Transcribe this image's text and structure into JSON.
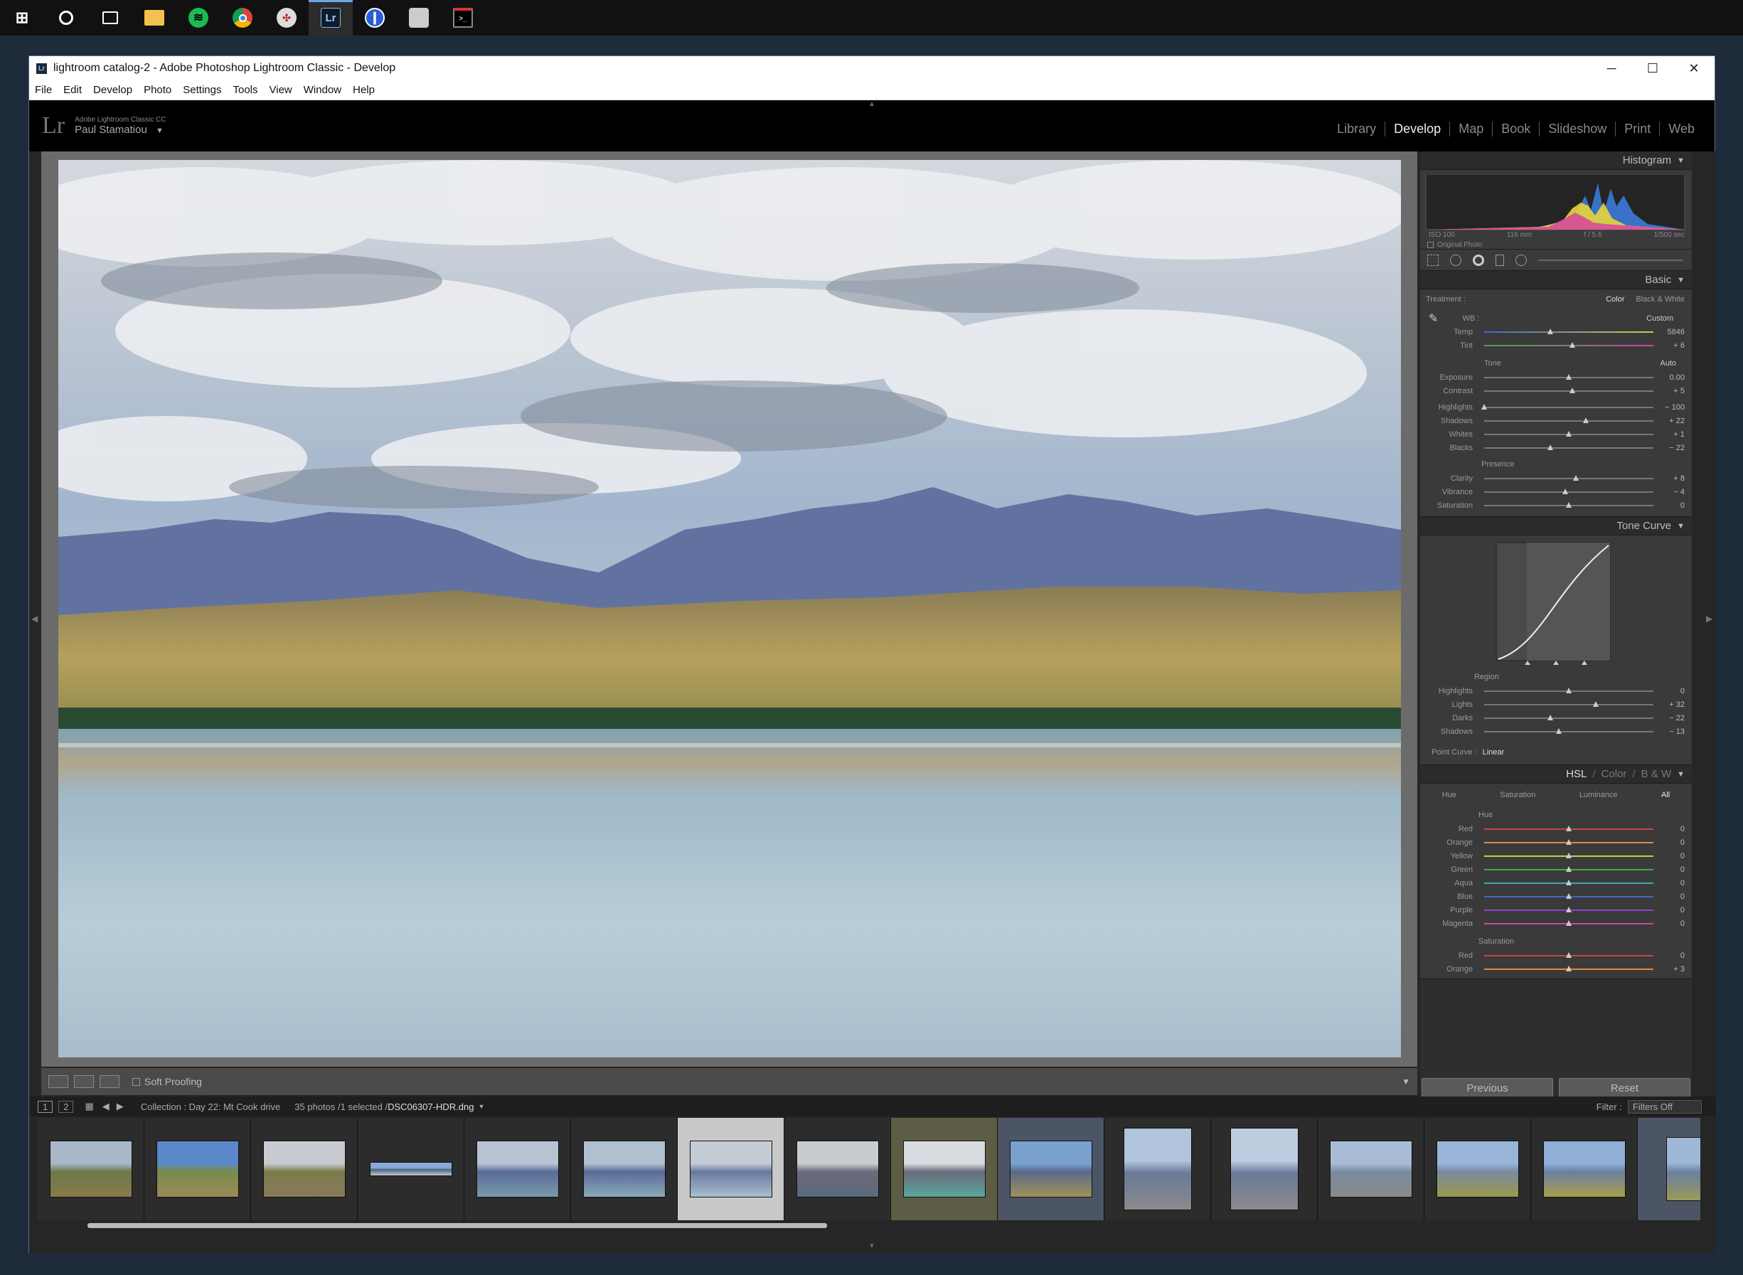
{
  "taskbar": {
    "icons": [
      "windows-start-icon",
      "cortana-icon",
      "task-view-icon",
      "file-explorer-icon",
      "spotify-icon",
      "chrome-icon",
      "slack-icon",
      "lightroom-icon",
      "onepassword-icon",
      "app-icon",
      "terminal-icon"
    ],
    "active_index": 7
  },
  "window": {
    "title": "lightroom catalog-2 - Adobe Photoshop Lightroom Classic - Develop",
    "controls": {
      "minimize": "─",
      "maximize": "☐",
      "close": "✕"
    }
  },
  "menu": [
    "File",
    "Edit",
    "Develop",
    "Photo",
    "Settings",
    "Tools",
    "View",
    "Window",
    "Help"
  ],
  "identity": {
    "logo": "Lr",
    "product": "Adobe Lightroom Classic CC",
    "user": "Paul Stamatiou"
  },
  "modules": [
    "Library",
    "Develop",
    "Map",
    "Book",
    "Slideshow",
    "Print",
    "Web"
  ],
  "active_module": "Develop",
  "histogram": {
    "title": "Histogram",
    "iso": "ISO 100",
    "focal": "116 mm",
    "aperture": "f / 5.6",
    "shutter": "1/500 sec",
    "original_label": "Original Photo"
  },
  "basic": {
    "title": "Basic",
    "treatment_label": "Treatment :",
    "treatment_color": "Color",
    "treatment_bw": "Black & White",
    "wb_label": "WB :",
    "wb_value": "Custom",
    "tone_label": "Tone",
    "auto_label": "Auto",
    "presence_label": "Presence",
    "sliders": [
      {
        "name": "Temp",
        "value": "5846",
        "pos": 0.39,
        "group": "wb"
      },
      {
        "name": "Tint",
        "value": "+ 6",
        "pos": 0.52,
        "group": "wb"
      },
      {
        "name": "Exposure",
        "value": "0.00",
        "pos": 0.5,
        "group": "tone"
      },
      {
        "name": "Contrast",
        "value": "+ 5",
        "pos": 0.52,
        "group": "tone"
      },
      {
        "name": "Highlights",
        "value": "− 100",
        "pos": 0.0,
        "group": "tone2"
      },
      {
        "name": "Shadows",
        "value": "+ 22",
        "pos": 0.6,
        "group": "tone2"
      },
      {
        "name": "Whites",
        "value": "+ 1",
        "pos": 0.5,
        "group": "tone2"
      },
      {
        "name": "Blacks",
        "value": "− 22",
        "pos": 0.39,
        "group": "tone2"
      },
      {
        "name": "Clarity",
        "value": "+ 8",
        "pos": 0.54,
        "group": "presence"
      },
      {
        "name": "Vibrance",
        "value": "− 4",
        "pos": 0.48,
        "group": "presence"
      },
      {
        "name": "Saturation",
        "value": "0",
        "pos": 0.5,
        "group": "presence"
      }
    ]
  },
  "tone_curve": {
    "title": "Tone Curve",
    "region_label": "Region",
    "sliders": [
      {
        "name": "Highlights",
        "value": "0",
        "pos": 0.5
      },
      {
        "name": "Lights",
        "value": "+ 32",
        "pos": 0.66
      },
      {
        "name": "Darks",
        "value": "− 22",
        "pos": 0.39
      },
      {
        "name": "Shadows",
        "value": "− 13",
        "pos": 0.44
      }
    ],
    "point_curve_label": "Point Curve :",
    "point_curve_value": "Linear"
  },
  "hsl": {
    "title": "HSL",
    "tab_color": "Color",
    "tab_bw": "B & W",
    "tabs": [
      "Hue",
      "Saturation",
      "Luminance",
      "All"
    ],
    "hue_label": "Hue",
    "saturation_label": "Saturation",
    "hue": [
      {
        "name": "Red",
        "value": "0",
        "color": "#c44"
      },
      {
        "name": "Orange",
        "value": "0",
        "color": "#d84"
      },
      {
        "name": "Yellow",
        "value": "0",
        "color": "#cc4"
      },
      {
        "name": "Green",
        "value": "0",
        "color": "#4a4"
      },
      {
        "name": "Aqua",
        "value": "0",
        "color": "#4aa"
      },
      {
        "name": "Blue",
        "value": "0",
        "color": "#46c"
      },
      {
        "name": "Purple",
        "value": "0",
        "color": "#84c"
      },
      {
        "name": "Magenta",
        "value": "0",
        "color": "#c4a"
      }
    ],
    "saturation": [
      {
        "name": "Red",
        "value": "0"
      },
      {
        "name": "Orange",
        "value": "+ 3"
      }
    ]
  },
  "footer": {
    "previous": "Previous",
    "reset": "Reset"
  },
  "toolbar": {
    "soft_proofing": "Soft Proofing"
  },
  "filmstrip": {
    "page1": "1",
    "page2": "2",
    "collection": "Collection : Day 22: Mt Cook drive",
    "count": "35 photos /1 selected /",
    "filename": "DSC06307-HDR.dng",
    "filter_label": "Filter :",
    "filter_value": "Filters Off",
    "selected_index": 6
  }
}
